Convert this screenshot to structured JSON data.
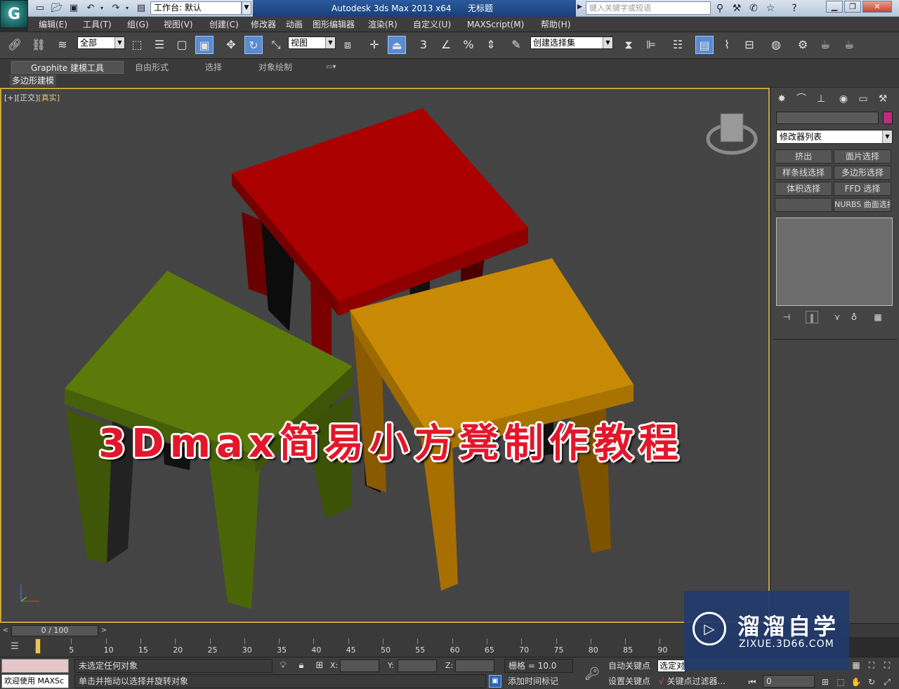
{
  "titlebar": {
    "workspace_label": "工作台: 默认",
    "app_title": "Autodesk 3ds Max  2013 x64",
    "doc_title": "无标题",
    "search_placeholder": "键入关键字或短语",
    "quick_access_icons": [
      "new-file-icon",
      "open-file-icon",
      "save-icon",
      "undo-icon",
      "redo-icon",
      "project-folder-icon"
    ],
    "help_icons": [
      "binoculars-icon",
      "subscription-icon",
      "communication-icon",
      "favorites-icon",
      "help-icon"
    ]
  },
  "menu": {
    "items": [
      "编辑(E)",
      "工具(T)",
      "组(G)",
      "视图(V)",
      "创建(C)",
      "修改器",
      "动画",
      "图形编辑器",
      "渲染(R)",
      "自定义(U)",
      "MAXScript(M)",
      "帮助(H)"
    ]
  },
  "toolbar": {
    "filter_value": "全部",
    "refcoord_value": "视图",
    "named_selection_value": "创建选择集",
    "snap_3d_label": "3"
  },
  "ribbon": {
    "tabs": [
      "Graphite 建模工具",
      "自由形式",
      "选择",
      "对象绘制"
    ],
    "sub_label": "多边形建模"
  },
  "viewport": {
    "label_plus": "[+]",
    "label_view": "[正交]",
    "label_shading": "[真实]",
    "overlay_title": "3Dmax简易小方凳制作教程",
    "colors": {
      "red_stool": "#b30000",
      "green_stool": "#5c7a0a",
      "orange_stool": "#c88a05"
    }
  },
  "command_panel": {
    "modifier_list": "修改器列表",
    "buttons": [
      "挤出",
      "面片选择",
      "样条线选择",
      "多边形选择",
      "体积选择",
      "FFD 选择",
      "",
      "NURBS 曲面选择"
    ]
  },
  "timeline": {
    "frame_display": "0 / 100",
    "ticks": [
      "0",
      "5",
      "10",
      "15",
      "20",
      "25",
      "30",
      "35",
      "40",
      "45",
      "50",
      "55",
      "60",
      "65",
      "70",
      "75",
      "80",
      "85",
      "90"
    ]
  },
  "status": {
    "maxscript_welcome": "欢迎使用 MAXSc",
    "selection": "未选定任何对象",
    "prompt": "单击并拖动以选择并旋转对象",
    "x_label": "X:",
    "y_label": "Y:",
    "z_label": "Z:",
    "grid": "栅格 = 10.0",
    "add_time_tag": "添加时间标记",
    "auto_key": "自动关键点",
    "set_key": "设置关键点",
    "selected": "选定对",
    "key_filters": "关键点过滤器...",
    "current_frame": "0"
  },
  "brand": {
    "name": "溜溜自学",
    "url": "ZIXUE.3D66.COM"
  }
}
